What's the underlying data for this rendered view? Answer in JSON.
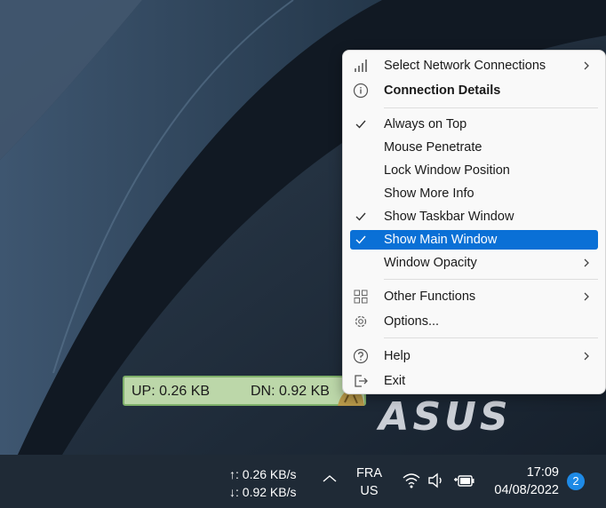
{
  "net_widget": {
    "up_text": "UP: 0.26 KB",
    "dn_text": "DN: 0.92 KB",
    "accent": "#bcd7a9"
  },
  "brand_logo": "ASUS",
  "context_menu": {
    "items": [
      {
        "label": "Select Network Connections",
        "icon": "signal-bars-icon",
        "submenu": true
      },
      {
        "label": "Connection Details",
        "icon": "info-icon",
        "bold": true
      },
      {
        "label": "Always on Top",
        "checked": true
      },
      {
        "label": "Mouse Penetrate"
      },
      {
        "label": "Lock Window Position"
      },
      {
        "label": "Show More Info"
      },
      {
        "label": "Show Taskbar Window",
        "checked": true
      },
      {
        "label": "Show Main Window",
        "checked": true,
        "highlighted": true
      },
      {
        "label": "Window Opacity",
        "submenu": true
      },
      {
        "label": "Other Functions",
        "icon": "grid-icon",
        "submenu": true
      },
      {
        "label": "Options...",
        "icon": "gear-icon"
      },
      {
        "label": "Help",
        "icon": "help-icon",
        "submenu": true
      },
      {
        "label": "Exit",
        "icon": "exit-icon"
      }
    ],
    "highlight_color": "#0a70d6"
  },
  "taskbar": {
    "upload_speed": "↑: 0.26 KB/s",
    "download_speed": "↓: 0.92 KB/s",
    "lang_primary": "FRA",
    "lang_secondary": "US",
    "time": "17:09",
    "date": "04/08/2022",
    "notification_count": "2",
    "tray_icons": [
      "wifi-icon",
      "speaker-icon",
      "battery-plug-icon"
    ]
  }
}
